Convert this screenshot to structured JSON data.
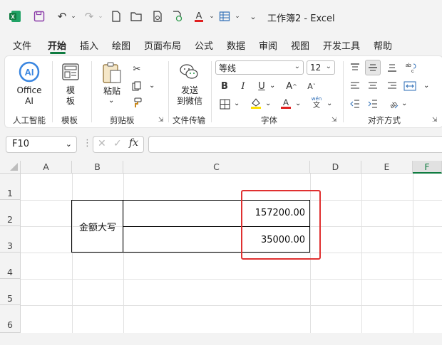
{
  "window": {
    "title": "工作簿2  -  Excel"
  },
  "menu": {
    "tabs": [
      "文件",
      "开始",
      "插入",
      "绘图",
      "页面布局",
      "公式",
      "数据",
      "审阅",
      "视图",
      "开发工具",
      "帮助"
    ],
    "active": "开始"
  },
  "ribbon": {
    "office_ai_label": "Office AI",
    "office_ai_line1": "Office",
    "office_ai_line2": "AI",
    "ai_badge": "AI",
    "template_line1": "模",
    "template_line2": "板",
    "paste_label": "粘贴",
    "send_line1": "发送",
    "send_line2": "到微信",
    "font_name": "等线",
    "font_size": "12",
    "bold": "B",
    "italic": "I",
    "underline": "U",
    "grow_font": "A",
    "shrink_font": "A",
    "font_color_a": "A",
    "phonetic_top": "wén",
    "phonetic_bottom": "文",
    "groups": [
      "人工智能",
      "模板",
      "剪贴板",
      "文件传输",
      "字体",
      "对齐方式"
    ]
  },
  "formula_bar": {
    "name_box": "F10",
    "fx": "fx",
    "formula": ""
  },
  "sheet": {
    "columns": [
      "A",
      "B",
      "C",
      "D",
      "E",
      "F"
    ],
    "rows": [
      "1",
      "2",
      "3",
      "4",
      "5",
      "6"
    ],
    "label_cell": "金额大写",
    "values": [
      "157200.00",
      "35000.00"
    ]
  },
  "colors": {
    "accent": "#107c41",
    "highlight": "#e03030"
  }
}
